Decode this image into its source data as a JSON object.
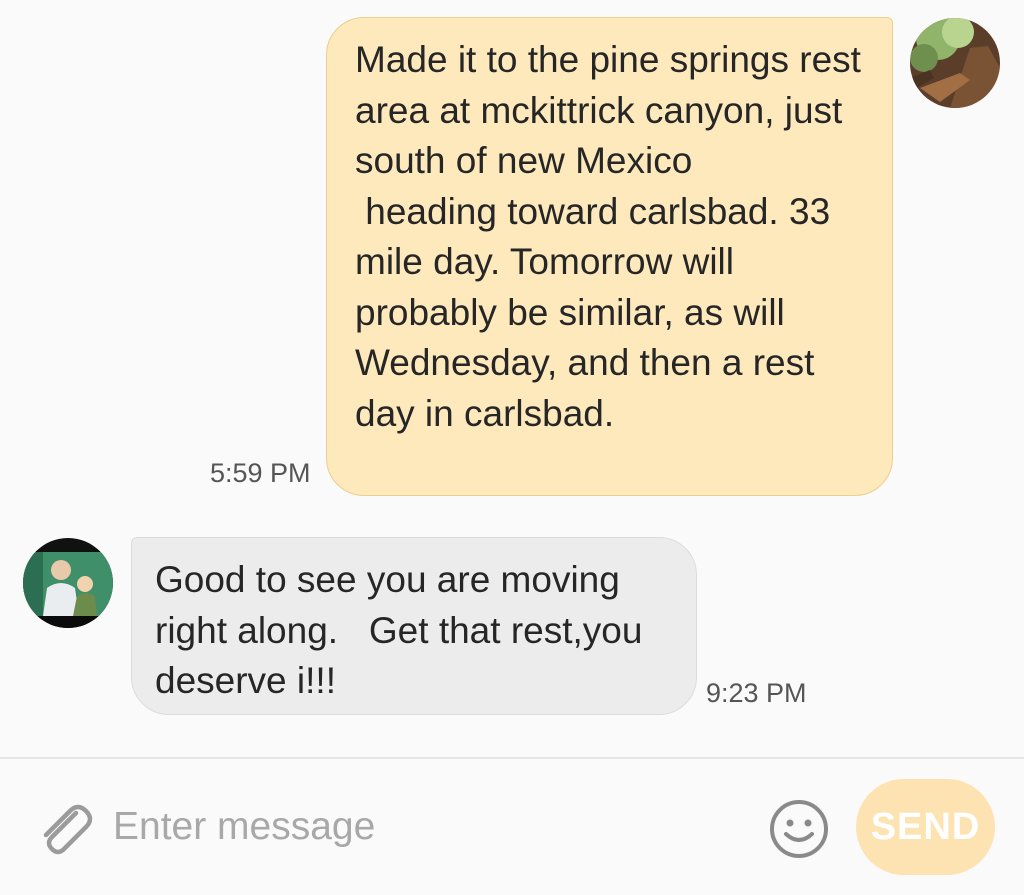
{
  "conversation": {
    "messages": [
      {
        "direction": "sent",
        "text": "Made it to the pine springs rest area at mckittrick canyon, just south of new Mexico\n heading toward carlsbad. 33 mile day. Tomorrow will probably be similar, as will Wednesday, and then a rest day in carlsbad.",
        "time": "5:59 PM"
      },
      {
        "direction": "received",
        "text": "Good to see you are moving right along.   Get that rest,you deserve i!!!",
        "time": "9:23 PM"
      }
    ]
  },
  "composer": {
    "placeholder": "Enter message",
    "value": "",
    "send_label": "SEND",
    "attach_icon": "paperclip-icon",
    "emoji_icon": "smiley-icon"
  },
  "colors": {
    "sent_bubble": "#fde9bc",
    "sent_bubble_border": "#ebcf8e",
    "received_bubble": "#ececec",
    "send_button": "#fde3b2",
    "background": "#fafafa"
  }
}
